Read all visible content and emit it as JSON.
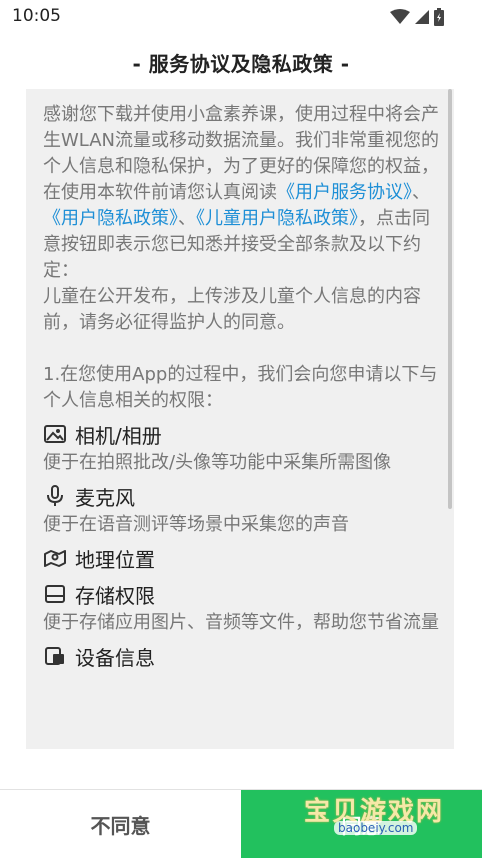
{
  "status_bar": {
    "time": "10:05"
  },
  "title": "- 服务协议及隐私政策 -",
  "intro": {
    "p1": "感谢您下载并使用小盒素养课，使用过程中将会产生WLAN流量或移动数据流量。我们非常重视您的个人信息和隐私保护，为了更好的保障您的权益，在使用本软件前请您认真阅读",
    "link_user_agreement": "《用户服务协议》",
    "sep1": "、",
    "link_privacy": "《用户隐私政策》",
    "sep2": "、",
    "link_child_privacy": "《儿童用户隐私政策》",
    "p1_end": "，点击同意按钮即表示您已知悉并接受全部条款及以下约定：",
    "p2": "儿童在公开发布，上传涉及儿童个人信息的内容前，请务必征得监护人的同意。",
    "p3": "1.在您使用App的过程中，我们会向您申请以下与个人信息相关的权限："
  },
  "permissions": [
    {
      "title": "相机/相册",
      "desc": "便于在拍照批改/头像等功能中采集所需图像",
      "icon": "image-icon"
    },
    {
      "title": "麦克风",
      "desc": "便于在语音测评等场景中采集您的声音",
      "icon": "microphone-icon"
    },
    {
      "title": "地理位置",
      "desc": "",
      "icon": "map-icon"
    },
    {
      "title": "存储权限",
      "desc": "便于存储应用图片、音频等文件，帮助您节省流量",
      "icon": "storage-icon"
    },
    {
      "title": "设备信息",
      "desc": "",
      "icon": "device-icon"
    }
  ],
  "buttons": {
    "disagree": "不同意",
    "agree": "同意"
  },
  "watermark": {
    "text": "宝贝游戏网",
    "url": "baobeiy.com"
  },
  "colors": {
    "link": "#1e8fd6",
    "agree_bg": "#22c15e",
    "content_bg": "#f0f0f0"
  }
}
